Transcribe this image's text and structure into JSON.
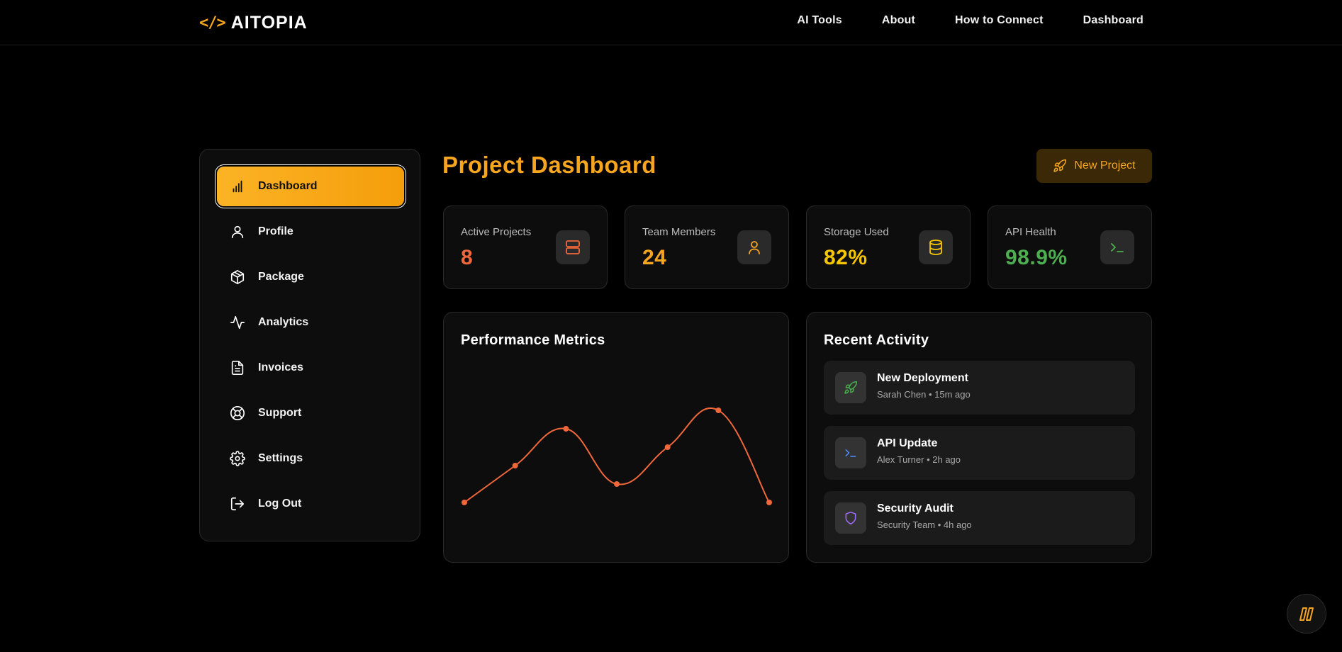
{
  "header": {
    "logo_mark": "</>",
    "brand": "AITOPIA",
    "nav": [
      "AI Tools",
      "About",
      "How to Connect",
      "Dashboard"
    ]
  },
  "sidebar": {
    "items": [
      {
        "label": "Dashboard",
        "icon": "bar-chart-icon",
        "active": true
      },
      {
        "label": "Profile",
        "icon": "user-icon"
      },
      {
        "label": "Package",
        "icon": "package-icon"
      },
      {
        "label": "Analytics",
        "icon": "activity-icon"
      },
      {
        "label": "Invoices",
        "icon": "file-text-icon"
      },
      {
        "label": "Support",
        "icon": "life-buoy-icon"
      },
      {
        "label": "Settings",
        "icon": "gear-icon"
      },
      {
        "label": "Log Out",
        "icon": "log-out-icon"
      }
    ]
  },
  "main": {
    "title": "Project Dashboard",
    "new_project_label": "New Project"
  },
  "stats": [
    {
      "label": "Active Projects",
      "value": "8",
      "color": "#f0683a",
      "icon": "server-icon"
    },
    {
      "label": "Team Members",
      "value": "24",
      "color": "#f6a51f",
      "icon": "user-icon"
    },
    {
      "label": "Storage Used",
      "value": "82%",
      "color": "#f7c600",
      "icon": "database-icon"
    },
    {
      "label": "API Health",
      "value": "98.9%",
      "color": "#4caf50",
      "icon": "terminal-icon"
    }
  ],
  "performance": {
    "title": "Performance Metrics"
  },
  "chart_data": {
    "type": "line",
    "title": "Performance Metrics",
    "series": [
      {
        "values": [
          20,
          40,
          60,
          30,
          50,
          70,
          20
        ]
      }
    ],
    "ylim": [
      0,
      100
    ],
    "color": "#f0683a",
    "grid": false
  },
  "activity": {
    "title": "Recent Activity",
    "items": [
      {
        "title": "New Deployment",
        "sub": "Sarah Chen • 15m ago",
        "icon": "rocket-icon",
        "color": "#4caf50"
      },
      {
        "title": "API Update",
        "sub": "Alex Turner • 2h ago",
        "icon": "terminal-icon",
        "color": "#4f8dff"
      },
      {
        "title": "Security Audit",
        "sub": "Security Team • 4h ago",
        "icon": "shield-icon",
        "color": "#a66cff"
      }
    ]
  },
  "colors": {
    "accent": "#f6a51f",
    "background": "#000000",
    "card": "#0d0d0d"
  }
}
